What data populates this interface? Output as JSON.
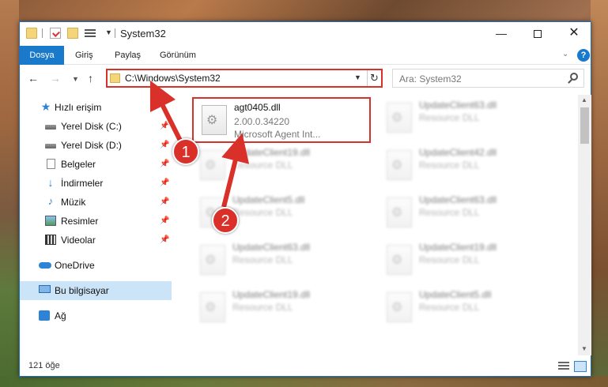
{
  "window": {
    "title": "System32",
    "minimize_glyph": "—",
    "close_glyph": "✕"
  },
  "ribbon": {
    "tabs": [
      "Dosya",
      "Giriş",
      "Paylaş",
      "Görünüm"
    ],
    "help_glyph": "?"
  },
  "navigation": {
    "address": "C:\\Windows\\System32",
    "search_placeholder": "Ara: System32"
  },
  "sidebar": {
    "items": [
      {
        "label": "Hızlı erişim",
        "icon": "star-icon"
      },
      {
        "label": "Yerel Disk (C:)",
        "icon": "drive-icon",
        "pinned": true
      },
      {
        "label": "Yerel Disk (D:)",
        "icon": "drive-icon",
        "pinned": true
      },
      {
        "label": "Belgeler",
        "icon": "documents-icon",
        "pinned": true
      },
      {
        "label": "İndirmeler",
        "icon": "download-icon",
        "pinned": true
      },
      {
        "label": "Müzik",
        "icon": "music-icon",
        "pinned": true
      },
      {
        "label": "Resimler",
        "icon": "pictures-icon",
        "pinned": true
      },
      {
        "label": "Videolar",
        "icon": "videos-icon",
        "pinned": true
      },
      {
        "label": "OneDrive",
        "icon": "cloud-icon"
      },
      {
        "label": "Bu bilgisayar",
        "icon": "computer-icon",
        "selected": true
      },
      {
        "label": "Ağ",
        "icon": "network-icon"
      }
    ]
  },
  "files": {
    "highlighted": {
      "name": "agt0405.dll",
      "version": "2.00.0.34220",
      "description": "Microsoft Agent Int..."
    },
    "others": [
      {
        "name": "UpdateClient63.dll",
        "type": "Resource DLL"
      },
      {
        "name": "UpdateClient19.dll",
        "type": "Resource DLL"
      },
      {
        "name": "UpdateClient42.dll",
        "type": "Resource DLL"
      },
      {
        "name": "UpdateClient5.dll",
        "type": "Resource DLL"
      },
      {
        "name": "UpdateClient63.dll",
        "type": "Resource DLL"
      },
      {
        "name": "UpdateClient63.dll",
        "type": "Resource DLL"
      },
      {
        "name": "UpdateClient19.dll",
        "type": "Resource DLL"
      },
      {
        "name": "UpdateClient19.dll",
        "type": "Resource DLL"
      },
      {
        "name": "UpdateClient5.dll",
        "type": "Resource DLL"
      }
    ]
  },
  "statusbar": {
    "item_count": "121 öğe"
  },
  "annotations": {
    "step1": "1",
    "step2": "2"
  },
  "colors": {
    "accent": "#1979ca",
    "highlight_red": "#d9302a",
    "selected_bg": "#cce4f7"
  }
}
